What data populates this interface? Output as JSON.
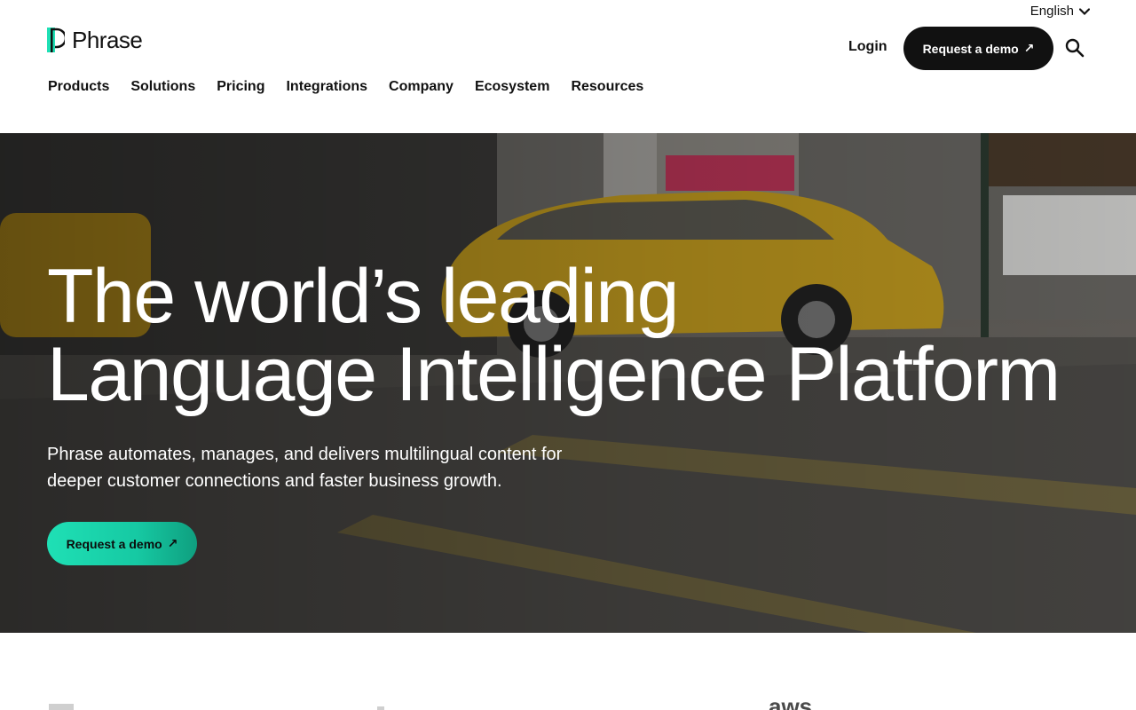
{
  "header": {
    "language": "English",
    "logo_text": "Phrase",
    "nav": [
      "Products",
      "Solutions",
      "Pricing",
      "Integrations",
      "Company",
      "Ecosystem",
      "Resources"
    ],
    "login": "Login",
    "cta": "Request a demo",
    "cta_icon": "↗"
  },
  "hero": {
    "headline_line1": "The world’s leading",
    "headline_line2": "Language Intelligence Platform",
    "subcopy": "Phrase automates, manages, and delivers multilingual content for deeper customer connections and faster business growth.",
    "cta": "Request a demo",
    "cta_icon": "↗"
  },
  "logos": {
    "partial_logo": "aws"
  },
  "colors": {
    "brand_green": "#1fe0b5",
    "dark_button": "#111111",
    "hero_text": "#ffffff"
  }
}
